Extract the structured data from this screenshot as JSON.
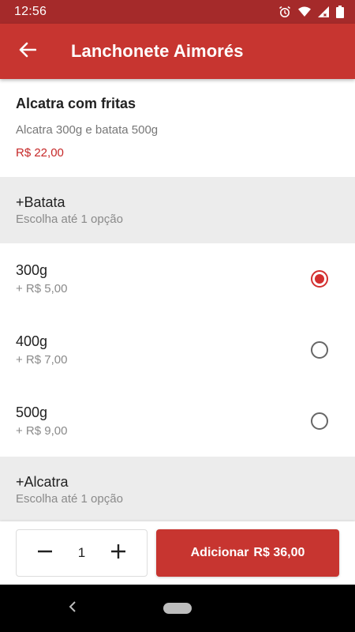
{
  "status_bar": {
    "time": "12:56",
    "icons": [
      "alarm-icon",
      "wifi-icon",
      "signal-icon",
      "battery-icon"
    ]
  },
  "app_bar": {
    "back_icon": "arrow-back-icon",
    "title": "Lanchonete Aimorés"
  },
  "product": {
    "name": "Alcatra com fritas",
    "description": "Alcatra 300g e batata 500g",
    "price": "R$ 22,00"
  },
  "groups": [
    {
      "title": "+Batata",
      "subtitle": "Escolha até 1 opção",
      "options": [
        {
          "label": "300g",
          "price": "+ R$ 5,00",
          "selected": true
        },
        {
          "label": "400g",
          "price": "+ R$ 7,00",
          "selected": false
        },
        {
          "label": "500g",
          "price": "+ R$ 9,00",
          "selected": false
        }
      ]
    },
    {
      "title": "+Alcatra",
      "subtitle": "Escolha até 1 opção",
      "options": []
    }
  ],
  "order": {
    "quantity": "1",
    "add_label": "Adicionar",
    "add_total": "R$ 36,00"
  },
  "colors": {
    "status_bar": "#a52a2a",
    "app_bar": "#c73530",
    "accent": "#d32f2f",
    "price": "#c62828",
    "group_bg": "#ececec"
  }
}
